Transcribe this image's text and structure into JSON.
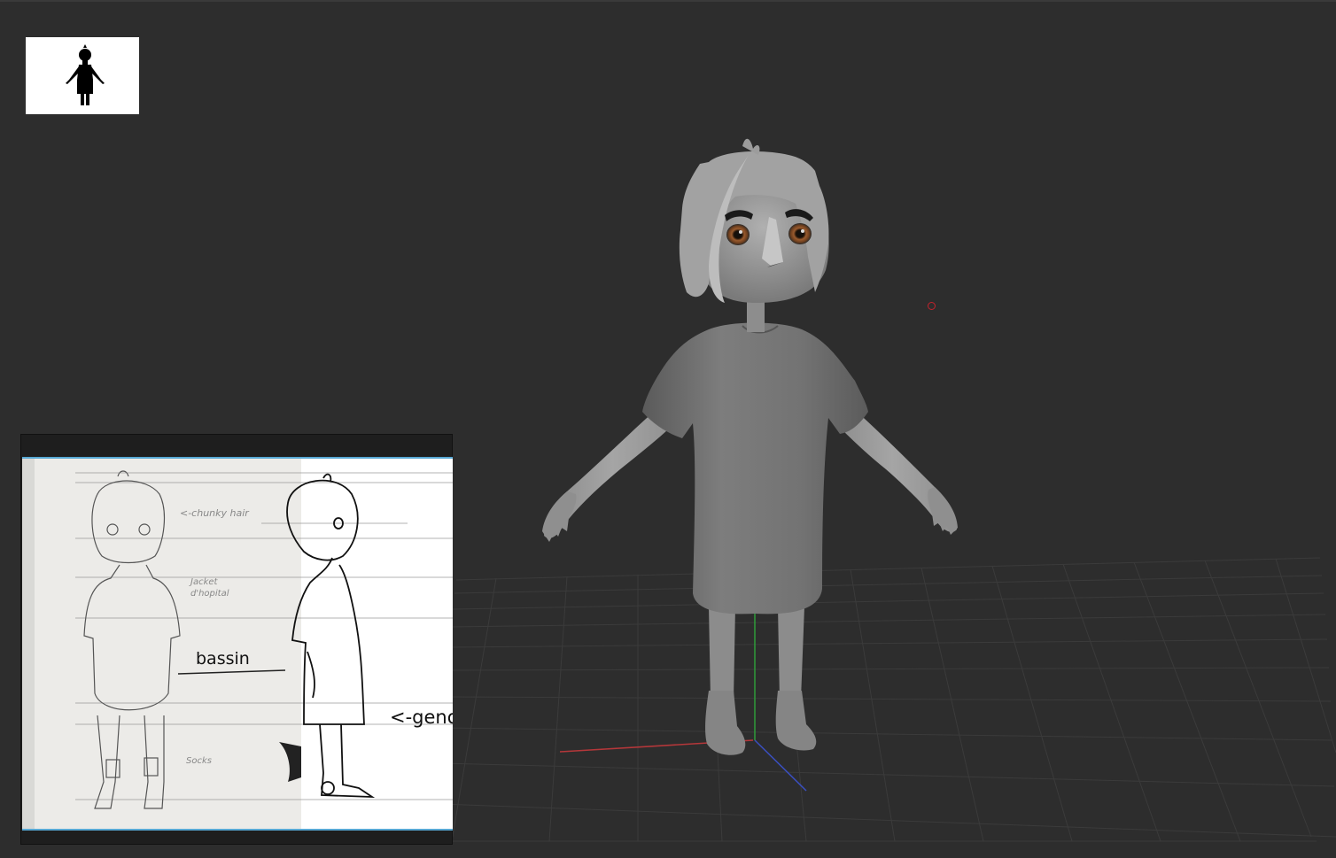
{
  "viewport": {
    "background": "#2d2d2d",
    "grid_color": "#3c3c3c",
    "axis_x_color": "#b5373a",
    "axis_y_color": "#2f9b3a",
    "axis_z_color": "#3a4fc0",
    "cursor_color": "#c4222c"
  },
  "navigator": {
    "icon": "character-silhouette-icon"
  },
  "model": {
    "icon": "character-model"
  },
  "reference_sheet": {
    "annotations": {
      "hair": "<-chunky hair",
      "jacket": "Jacket d'hopital",
      "bassin": "bassin",
      "genoux": "<-genoux",
      "socks": "Socks"
    },
    "accent_color": "#57a8d4"
  }
}
